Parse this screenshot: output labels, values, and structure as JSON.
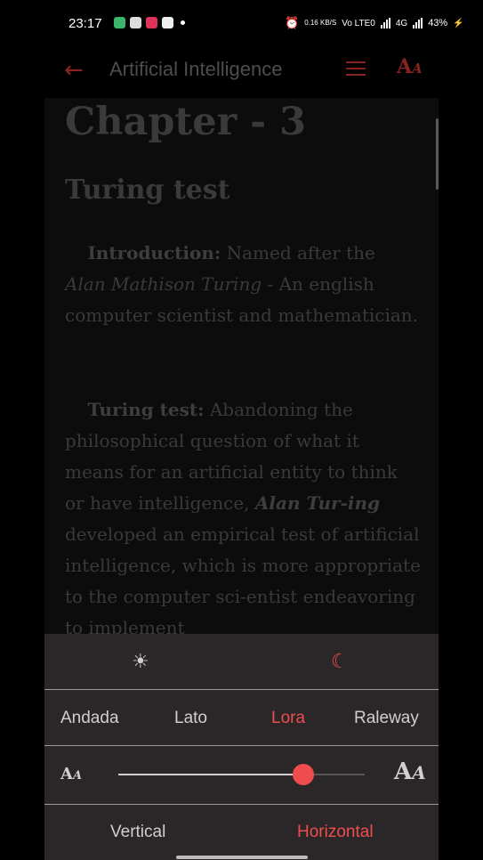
{
  "status_bar": {
    "time": "23:17",
    "net_speed": "0.16 KB/S",
    "volte": "Vo LTE0",
    "network": "4G",
    "battery": "43%"
  },
  "app_bar": {
    "title": "Artificial Intelligence",
    "back_icon": "arrow-left-icon",
    "menu_icon": "hamburger-icon",
    "font_icon": "font-size-icon"
  },
  "content": {
    "chapter": "Chapter - 3",
    "section": "Turing test",
    "p1_label": "Introduction:",
    "p1_text_a": " Named after the ",
    "p1_italic": "Alan Mathison Turing",
    "p1_text_b": " - An english computer scientist and mathematician.",
    "p2_label": "Turing test:",
    "p2_text_a": " Abandoning the philosophical question of what it means for an artificial entity to think or have intelligence, ",
    "p2_italic": "Alan Tur-ing",
    "p2_text_b": " developed an empirical test of artificial intelligence, which is more appropriate to the computer sci-entist endeavoring to implement"
  },
  "settings": {
    "theme_light_icon": "sun-icon",
    "theme_dark_icon": "moon-icon",
    "fonts": [
      "Andada",
      "Lato",
      "Lora",
      "Raleway"
    ],
    "selected_font": "Lora",
    "size_small_label": "A",
    "size_large_label": "A",
    "font_size_fraction": 0.75,
    "orientation": [
      "Vertical",
      "Horizontal"
    ],
    "selected_orientation": "Horizontal"
  },
  "colors": {
    "accent": "#ef4d4d",
    "dim_accent": "#8a2222"
  }
}
